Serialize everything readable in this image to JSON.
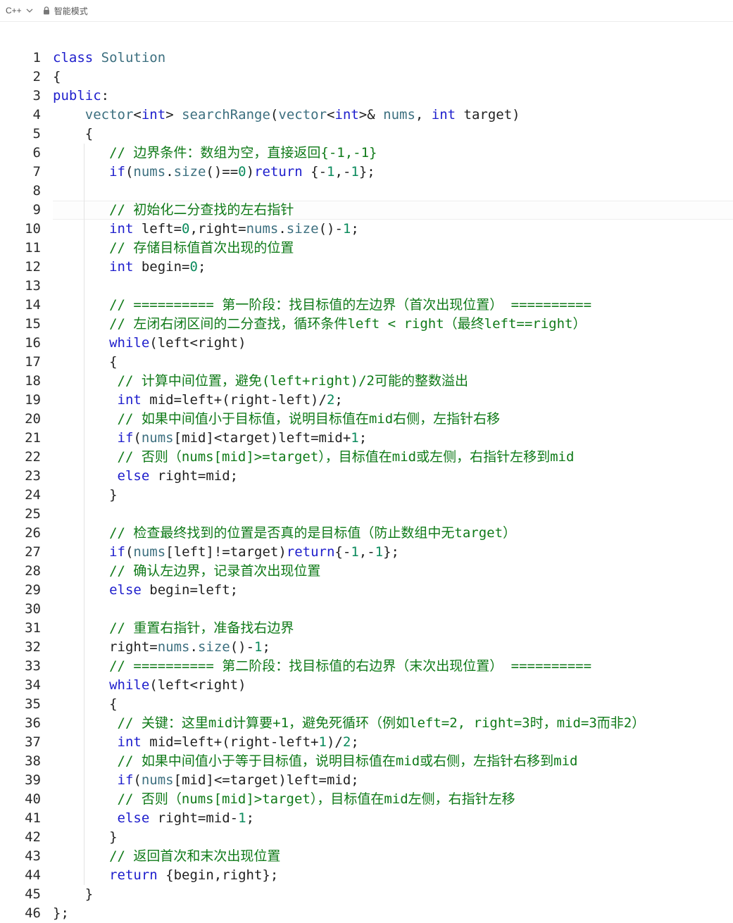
{
  "toolbar": {
    "language": "C++",
    "mode_label": "智能模式"
  },
  "editor": {
    "active_line": 9,
    "lines": [
      {
        "n": "1",
        "t": [
          [
            "kw",
            "class"
          ],
          [
            "txt",
            " "
          ],
          [
            "fn",
            "Solution"
          ]
        ]
      },
      {
        "n": "2",
        "t": [
          [
            "txt",
            "{"
          ]
        ]
      },
      {
        "n": "3",
        "t": [
          [
            "kw",
            "public"
          ],
          [
            "txt",
            ":"
          ]
        ]
      },
      {
        "n": "4",
        "t": [
          [
            "txt",
            "    "
          ],
          [
            "fn",
            "vector"
          ],
          [
            "txt",
            "<"
          ],
          [
            "kt",
            "int"
          ],
          [
            "txt",
            "> "
          ],
          [
            "fn",
            "searchRange"
          ],
          [
            "txt",
            "("
          ],
          [
            "fn",
            "vector"
          ],
          [
            "txt",
            "<"
          ],
          [
            "kt",
            "int"
          ],
          [
            "txt",
            ">& "
          ],
          [
            "fn",
            "nums"
          ],
          [
            "txt",
            ", "
          ],
          [
            "kt",
            "int"
          ],
          [
            "txt",
            " target)"
          ]
        ]
      },
      {
        "n": "5",
        "t": [
          [
            "txt",
            "    {"
          ]
        ]
      },
      {
        "n": "6",
        "t": [
          [
            "txt",
            "       "
          ],
          [
            "cm",
            "// 边界条件：数组为空，直接返回{-1,-1}"
          ]
        ]
      },
      {
        "n": "7",
        "t": [
          [
            "txt",
            "       "
          ],
          [
            "kw",
            "if"
          ],
          [
            "txt",
            "("
          ],
          [
            "fn",
            "nums"
          ],
          [
            "txt",
            "."
          ],
          [
            "fn",
            "size"
          ],
          [
            "txt",
            "()=="
          ],
          [
            "num",
            "0"
          ],
          [
            "txt",
            ")"
          ],
          [
            "kw",
            "return"
          ],
          [
            "txt",
            " {-"
          ],
          [
            "num",
            "1"
          ],
          [
            "txt",
            ",-"
          ],
          [
            "num",
            "1"
          ],
          [
            "txt",
            "};"
          ]
        ]
      },
      {
        "n": "8",
        "t": []
      },
      {
        "n": "9",
        "t": [
          [
            "txt",
            "       "
          ],
          [
            "cm",
            "// 初始化二分查找的左右指针"
          ]
        ]
      },
      {
        "n": "10",
        "t": [
          [
            "txt",
            "       "
          ],
          [
            "kt",
            "int"
          ],
          [
            "txt",
            " left="
          ],
          [
            "num",
            "0"
          ],
          [
            "txt",
            ",right="
          ],
          [
            "fn",
            "nums"
          ],
          [
            "txt",
            "."
          ],
          [
            "fn",
            "size"
          ],
          [
            "txt",
            "()-"
          ],
          [
            "num",
            "1"
          ],
          [
            "txt",
            ";"
          ]
        ]
      },
      {
        "n": "11",
        "t": [
          [
            "txt",
            "       "
          ],
          [
            "cm",
            "// 存储目标值首次出现的位置"
          ]
        ]
      },
      {
        "n": "12",
        "t": [
          [
            "txt",
            "       "
          ],
          [
            "kt",
            "int"
          ],
          [
            "txt",
            " begin="
          ],
          [
            "num",
            "0"
          ],
          [
            "txt",
            ";"
          ]
        ]
      },
      {
        "n": "13",
        "t": []
      },
      {
        "n": "14",
        "t": [
          [
            "txt",
            "       "
          ],
          [
            "cm",
            "// ========== 第一阶段：找目标值的左边界（首次出现位置） =========="
          ]
        ]
      },
      {
        "n": "15",
        "t": [
          [
            "txt",
            "       "
          ],
          [
            "cm",
            "// 左闭右闭区间的二分查找，循环条件left < right（最终left==right）"
          ]
        ]
      },
      {
        "n": "16",
        "t": [
          [
            "txt",
            "       "
          ],
          [
            "kw",
            "while"
          ],
          [
            "txt",
            "(left<right)"
          ]
        ]
      },
      {
        "n": "17",
        "t": [
          [
            "txt",
            "       {"
          ]
        ]
      },
      {
        "n": "18",
        "t": [
          [
            "txt",
            "        "
          ],
          [
            "cm",
            "// 计算中间位置，避免(left+right)/2可能的整数溢出"
          ]
        ]
      },
      {
        "n": "19",
        "t": [
          [
            "txt",
            "        "
          ],
          [
            "kt",
            "int"
          ],
          [
            "txt",
            " mid=left+(right-left)/"
          ],
          [
            "num",
            "2"
          ],
          [
            "txt",
            ";"
          ]
        ]
      },
      {
        "n": "20",
        "t": [
          [
            "txt",
            "        "
          ],
          [
            "cm",
            "// 如果中间值小于目标值，说明目标值在mid右侧，左指针右移"
          ]
        ]
      },
      {
        "n": "21",
        "t": [
          [
            "txt",
            "        "
          ],
          [
            "kw",
            "if"
          ],
          [
            "txt",
            "("
          ],
          [
            "fn",
            "nums"
          ],
          [
            "txt",
            "[mid]<target)left=mid+"
          ],
          [
            "num",
            "1"
          ],
          [
            "txt",
            ";"
          ]
        ]
      },
      {
        "n": "22",
        "t": [
          [
            "txt",
            "        "
          ],
          [
            "cm",
            "// 否则（nums[mid]>=target），目标值在mid或左侧，右指针左移到mid"
          ]
        ]
      },
      {
        "n": "23",
        "t": [
          [
            "txt",
            "        "
          ],
          [
            "kw",
            "else"
          ],
          [
            "txt",
            " right=mid;"
          ]
        ]
      },
      {
        "n": "24",
        "t": [
          [
            "txt",
            "       }"
          ]
        ]
      },
      {
        "n": "25",
        "t": []
      },
      {
        "n": "26",
        "t": [
          [
            "txt",
            "       "
          ],
          [
            "cm",
            "// 检查最终找到的位置是否真的是目标值（防止数组中无target）"
          ]
        ]
      },
      {
        "n": "27",
        "t": [
          [
            "txt",
            "       "
          ],
          [
            "kw",
            "if"
          ],
          [
            "txt",
            "("
          ],
          [
            "fn",
            "nums"
          ],
          [
            "txt",
            "[left]!=target)"
          ],
          [
            "kw",
            "return"
          ],
          [
            "txt",
            "{-"
          ],
          [
            "num",
            "1"
          ],
          [
            "txt",
            ",-"
          ],
          [
            "num",
            "1"
          ],
          [
            "txt",
            "};"
          ]
        ]
      },
      {
        "n": "28",
        "t": [
          [
            "txt",
            "       "
          ],
          [
            "cm",
            "// 确认左边界，记录首次出现位置"
          ]
        ]
      },
      {
        "n": "29",
        "t": [
          [
            "txt",
            "       "
          ],
          [
            "kw",
            "else"
          ],
          [
            "txt",
            " begin=left;"
          ]
        ]
      },
      {
        "n": "30",
        "t": []
      },
      {
        "n": "31",
        "t": [
          [
            "txt",
            "       "
          ],
          [
            "cm",
            "// 重置右指针，准备找右边界"
          ]
        ]
      },
      {
        "n": "32",
        "t": [
          [
            "txt",
            "       right="
          ],
          [
            "fn",
            "nums"
          ],
          [
            "txt",
            "."
          ],
          [
            "fn",
            "size"
          ],
          [
            "txt",
            "()-"
          ],
          [
            "num",
            "1"
          ],
          [
            "txt",
            ";"
          ]
        ]
      },
      {
        "n": "33",
        "t": [
          [
            "txt",
            "       "
          ],
          [
            "cm",
            "// ========== 第二阶段：找目标值的右边界（末次出现位置） =========="
          ]
        ]
      },
      {
        "n": "34",
        "t": [
          [
            "txt",
            "       "
          ],
          [
            "kw",
            "while"
          ],
          [
            "txt",
            "(left<right)"
          ]
        ]
      },
      {
        "n": "35",
        "t": [
          [
            "txt",
            "       {"
          ]
        ]
      },
      {
        "n": "36",
        "t": [
          [
            "txt",
            "        "
          ],
          [
            "cm",
            "// 关键：这里mid计算要+1，避免死循环（例如left=2, right=3时，mid=3而非2）"
          ]
        ]
      },
      {
        "n": "37",
        "t": [
          [
            "txt",
            "        "
          ],
          [
            "kt",
            "int"
          ],
          [
            "txt",
            " mid=left+(right-left+"
          ],
          [
            "num",
            "1"
          ],
          [
            "txt",
            ")/"
          ],
          [
            "num",
            "2"
          ],
          [
            "txt",
            ";"
          ]
        ]
      },
      {
        "n": "38",
        "t": [
          [
            "txt",
            "        "
          ],
          [
            "cm",
            "// 如果中间值小于等于目标值，说明目标值在mid或右侧，左指针右移到mid"
          ]
        ]
      },
      {
        "n": "39",
        "t": [
          [
            "txt",
            "        "
          ],
          [
            "kw",
            "if"
          ],
          [
            "txt",
            "("
          ],
          [
            "fn",
            "nums"
          ],
          [
            "txt",
            "[mid]<=target)left=mid;"
          ]
        ]
      },
      {
        "n": "40",
        "t": [
          [
            "txt",
            "        "
          ],
          [
            "cm",
            "// 否则（nums[mid]>target），目标值在mid左侧，右指针左移"
          ]
        ]
      },
      {
        "n": "41",
        "t": [
          [
            "txt",
            "        "
          ],
          [
            "kw",
            "else"
          ],
          [
            "txt",
            " right=mid-"
          ],
          [
            "num",
            "1"
          ],
          [
            "txt",
            ";"
          ]
        ]
      },
      {
        "n": "42",
        "t": [
          [
            "txt",
            "       }"
          ]
        ]
      },
      {
        "n": "43",
        "t": [
          [
            "txt",
            "       "
          ],
          [
            "cm",
            "// 返回首次和末次出现位置"
          ]
        ]
      },
      {
        "n": "44",
        "t": [
          [
            "txt",
            "       "
          ],
          [
            "kw",
            "return"
          ],
          [
            "txt",
            " {begin,right};"
          ]
        ]
      },
      {
        "n": "45",
        "t": [
          [
            "txt",
            "    }"
          ]
        ]
      },
      {
        "n": "46",
        "t": [
          [
            "txt",
            "};"
          ]
        ]
      }
    ]
  }
}
